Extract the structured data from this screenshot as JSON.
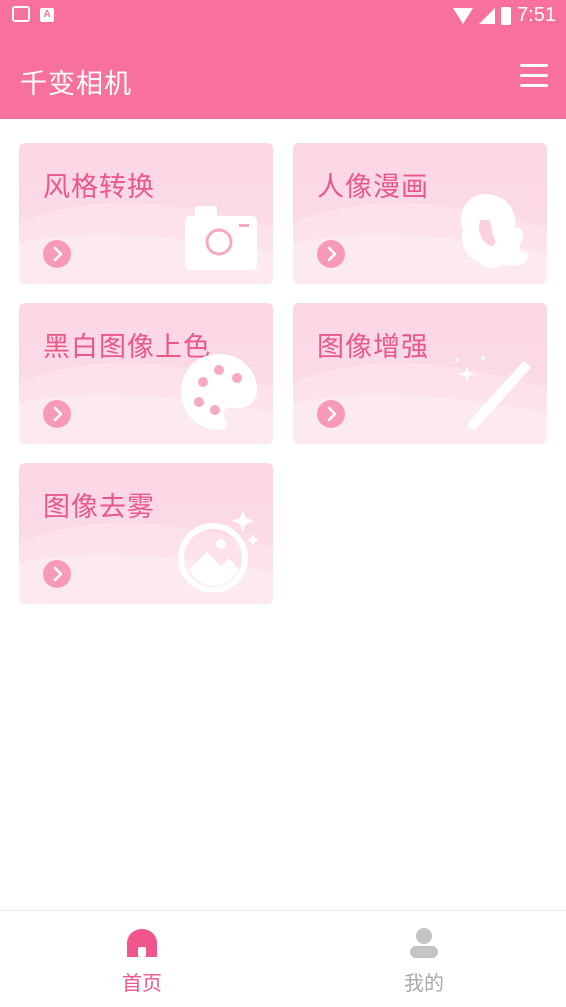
{
  "status_bar": {
    "time": "7:51",
    "notification_icons": [
      "mail-icon",
      "a-icon"
    ],
    "a_badge": "A"
  },
  "app_bar": {
    "title": "千变相机",
    "menu_icon": "menu-icon"
  },
  "cards": [
    {
      "title": "风格转换",
      "icon": "camera-icon"
    },
    {
      "title": "人像漫画",
      "icon": "portrait-hair-icon"
    },
    {
      "title": "黑白图像上色",
      "icon": "palette-icon"
    },
    {
      "title": "图像增强",
      "icon": "magic-wand-icon"
    },
    {
      "title": "图像去雾",
      "icon": "image-sparkle-icon"
    }
  ],
  "bottom_nav": {
    "items": [
      {
        "label": "首页",
        "icon": "home-icon",
        "active": true
      },
      {
        "label": "我的",
        "icon": "user-icon",
        "active": false
      }
    ]
  },
  "colors": {
    "primary": "#f7719c",
    "card_title": "#e9578c",
    "active_nav": "#f0558c",
    "inactive_nav": "#aaaaaa"
  }
}
